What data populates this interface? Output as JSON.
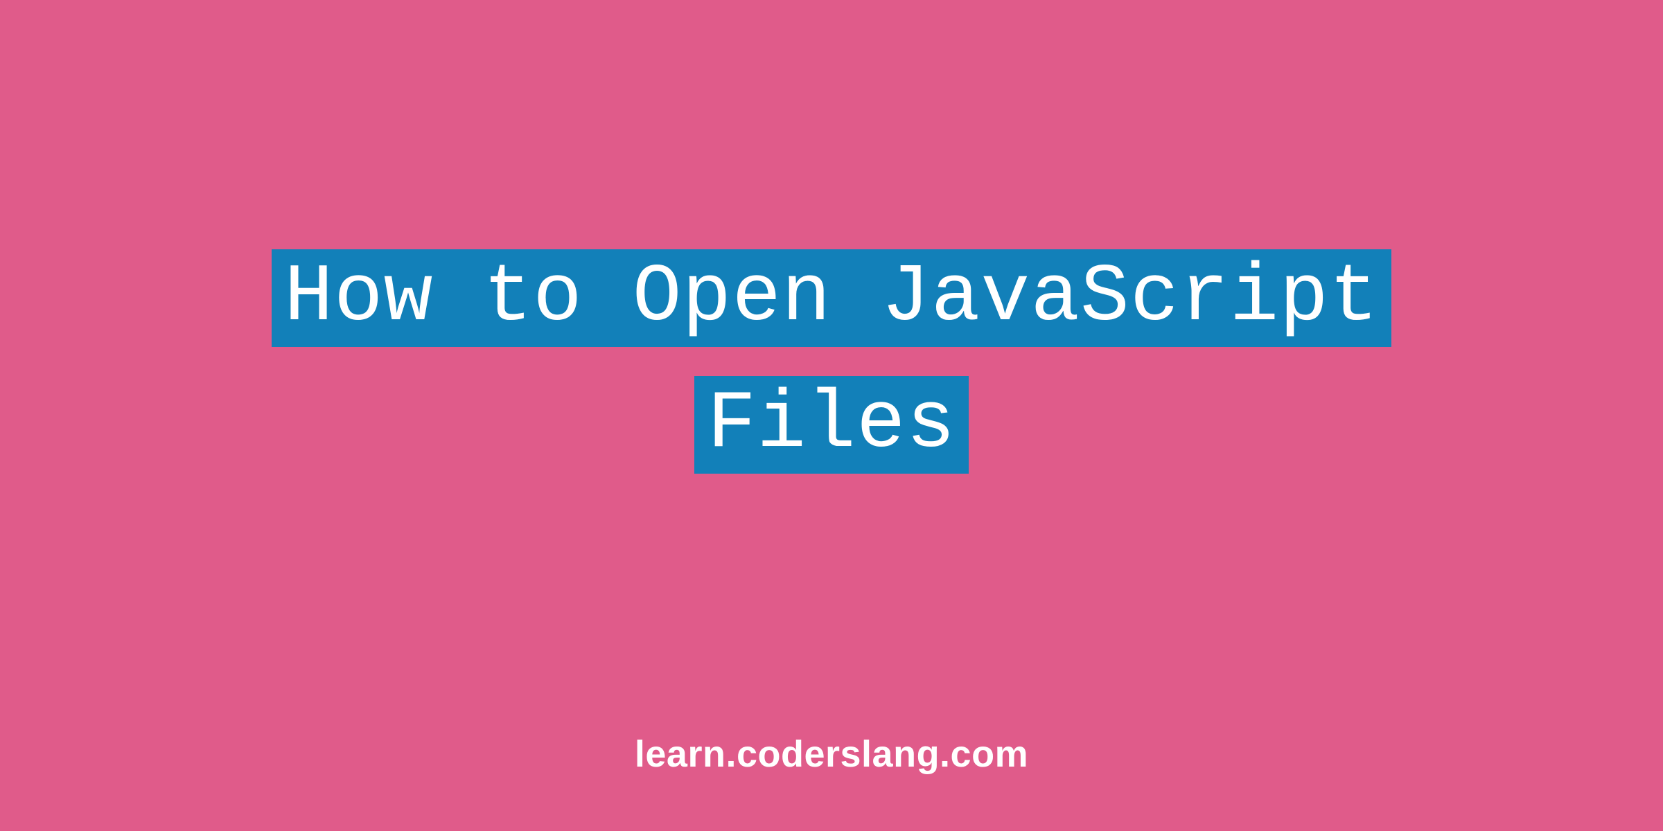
{
  "title": {
    "line1": "How to Open JavaScript",
    "line2": "Files"
  },
  "footer": {
    "site": "learn.coderslang.com"
  },
  "colors": {
    "background": "#e05b8a",
    "highlight": "#1280b9",
    "text": "#ffffff"
  }
}
